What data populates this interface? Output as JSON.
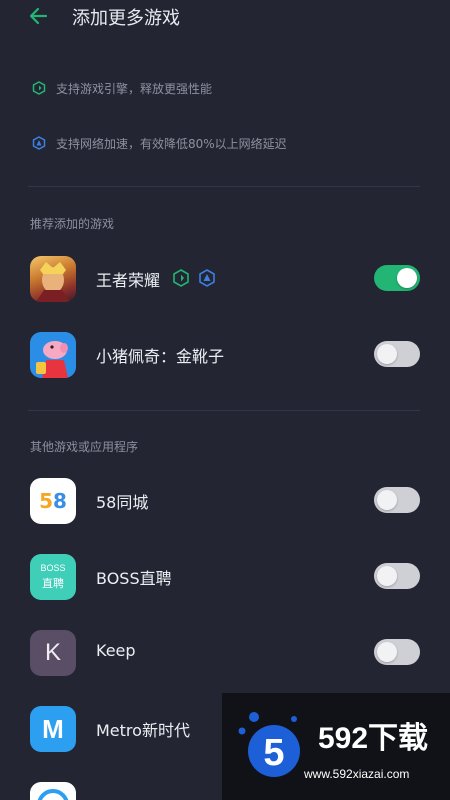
{
  "header": {
    "title": "添加更多游戏",
    "back_icon": "arrow-left-icon",
    "accent": "#22b573"
  },
  "features": [
    {
      "icon": "hexagon-boost-icon",
      "text": "支持游戏引擎，释放更强性能"
    },
    {
      "icon": "hexagon-network-icon",
      "text": "支持网络加速，有效降低80%以上网络延迟"
    }
  ],
  "recommended": {
    "title": "推荐添加的游戏",
    "items": [
      {
        "name": "王者荣耀",
        "icon": "honor-of-kings-icon",
        "toggled": true,
        "badges": [
          "hexagon-boost-icon",
          "hexagon-network-icon"
        ]
      },
      {
        "name": "小猪佩奇：金靴子",
        "icon": "peppa-pig-icon",
        "toggled": false
      }
    ]
  },
  "others": {
    "title": "其他游戏或应用程序",
    "items": [
      {
        "name": "58同城",
        "icon": "58-tongcheng-icon",
        "icon_text": "58",
        "toggled": false
      },
      {
        "name": "BOSS直聘",
        "icon": "boss-zhipin-icon",
        "icon_text_top": "BOSS",
        "icon_text_bottom": "直聘",
        "toggled": false
      },
      {
        "name": "Keep",
        "icon": "keep-icon",
        "icon_text": "K",
        "toggled": false
      },
      {
        "name": "Metro新时代",
        "icon": "metro-icon",
        "icon_text": "M",
        "toggled": false
      },
      {
        "name": "",
        "icon": "partial-app-icon",
        "toggled": false
      }
    ]
  },
  "watermark": {
    "brand": "592下载",
    "url": "www.592xiazai.com",
    "logo_digit": "5"
  },
  "colors": {
    "background": "#232532",
    "toggle_on": "#22b573",
    "toggle_off": "#cfd0d6"
  }
}
